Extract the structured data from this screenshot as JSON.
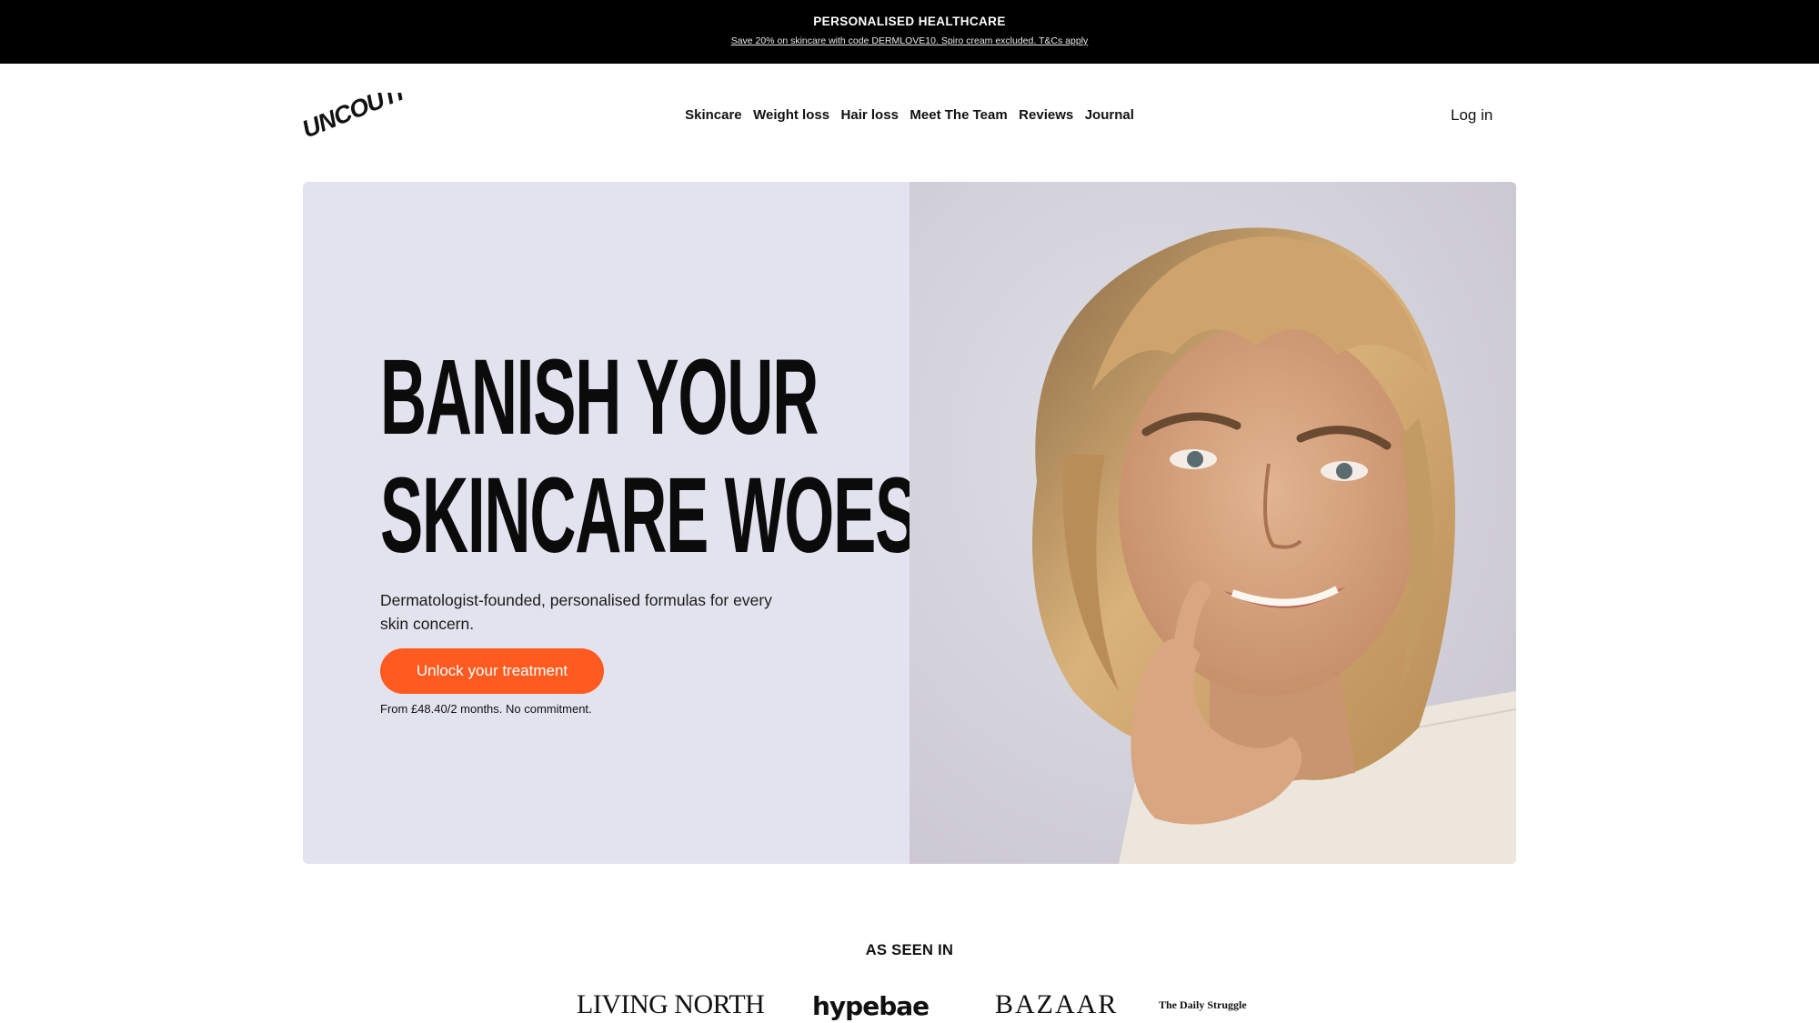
{
  "announcement": {
    "title": "PERSONALISED HEALTHCARE",
    "offer": "Save 20% on skincare with code DERMLOVE10. Spiro cream excluded. T&Cs apply"
  },
  "header": {
    "logo_text": "UNCOUTH",
    "nav": [
      "Skincare",
      "Weight loss",
      "Hair loss",
      "Meet The Team",
      "Reviews",
      "Journal"
    ],
    "login_label": "Log in"
  },
  "hero": {
    "headline_line1": "BANISH YOUR",
    "headline_line2": "SKINCARE WOES.",
    "subtext": "Dermatologist-founded, personalised formulas for every skin concern.",
    "cta_label": "Unlock your treatment",
    "price_note": "From £48.40/2 months. No commitment.",
    "colors": {
      "panel_bg": "#e3e3ef",
      "cta_bg": "#ff5a1f"
    }
  },
  "press": {
    "title": "AS SEEN IN",
    "logos": [
      "LIVING NORTH",
      "hypebae",
      "BAZAAR",
      "The Daily Struggle"
    ]
  }
}
